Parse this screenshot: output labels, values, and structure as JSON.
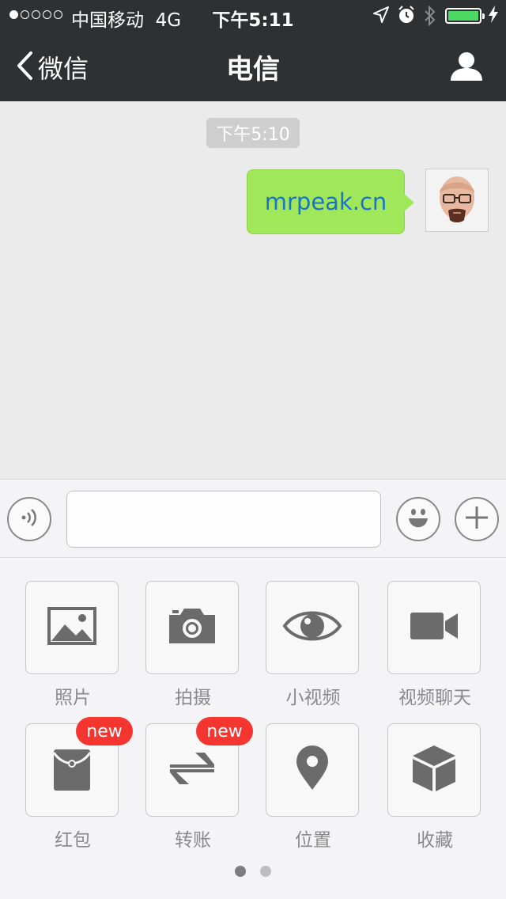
{
  "status_bar": {
    "signal_dots": [
      true,
      false,
      false,
      false,
      false
    ],
    "carrier": "中国移动",
    "network": "4G",
    "time": "下午5:11",
    "battery_level": 1.0,
    "battery_color": "#4cd964",
    "icons": [
      "location-arrow-icon",
      "alarm-icon",
      "bluetooth-icon",
      "battery-icon",
      "charging-bolt-icon"
    ]
  },
  "nav": {
    "back_label": "微信",
    "title": "电信",
    "right_icon": "person-icon"
  },
  "chat": {
    "timestamp": "下午5:10",
    "messages": [
      {
        "from": "me",
        "text": "mrpeak.cn",
        "bubble_color": "#a0e75a",
        "link_color": "#1a73c9"
      }
    ]
  },
  "input_bar": {
    "voice_icon": "voice-icon",
    "emoji_icon": "emoji-icon",
    "plus_icon": "plus-icon",
    "text_value": ""
  },
  "tools": [
    {
      "label": "照片",
      "icon": "photo-icon",
      "badge": ""
    },
    {
      "label": "拍摄",
      "icon": "camera-icon",
      "badge": ""
    },
    {
      "label": "小视频",
      "icon": "eye-icon",
      "badge": ""
    },
    {
      "label": "视频聊天",
      "icon": "video-camera-icon",
      "badge": ""
    },
    {
      "label": "红包",
      "icon": "red-packet-icon",
      "badge": "new"
    },
    {
      "label": "转账",
      "icon": "transfer-icon",
      "badge": "new"
    },
    {
      "label": "位置",
      "icon": "location-pin-icon",
      "badge": ""
    },
    {
      "label": "收藏",
      "icon": "favorites-box-icon",
      "badge": ""
    }
  ],
  "pager": {
    "pages": 2,
    "current": 1
  },
  "colors": {
    "navbar": "#2e3133",
    "badge": "#f43530",
    "icon_gray": "#6b6b6b"
  }
}
